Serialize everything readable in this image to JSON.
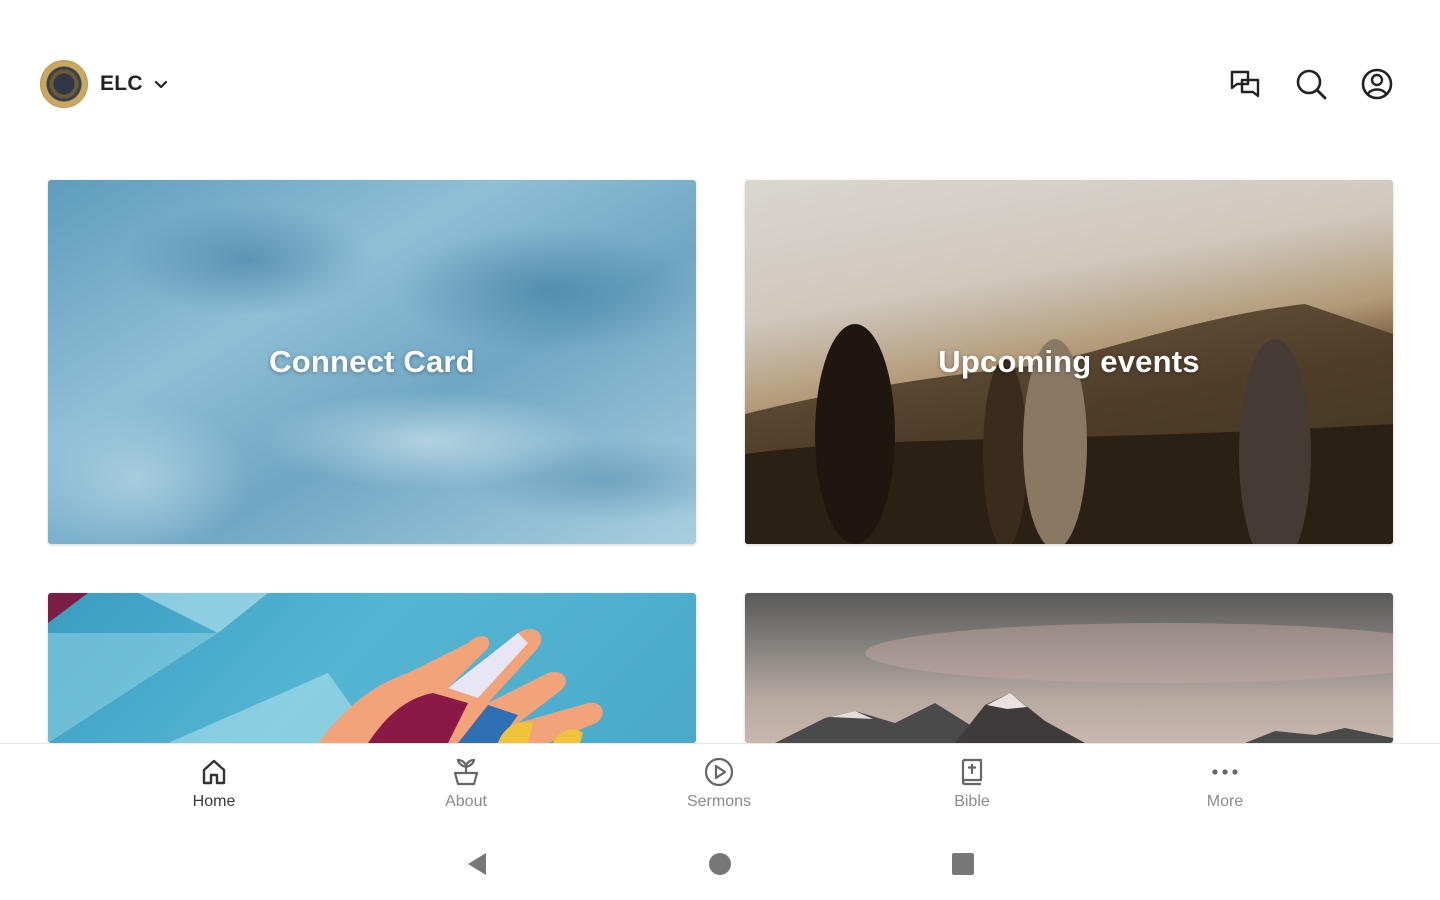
{
  "header": {
    "org_name": "ELC",
    "icons": [
      "chat-icon",
      "search-icon",
      "profile-icon"
    ]
  },
  "cards": [
    {
      "title": "Connect Card"
    },
    {
      "title": "Upcoming events"
    },
    {
      "title": ""
    },
    {
      "title": ""
    }
  ],
  "bottom_nav": {
    "items": [
      {
        "label": "Home",
        "icon": "home-icon",
        "active": true
      },
      {
        "label": "About",
        "icon": "plant-icon",
        "active": false
      },
      {
        "label": "Sermons",
        "icon": "play-circle-icon",
        "active": false
      },
      {
        "label": "Bible",
        "icon": "bible-icon",
        "active": false
      },
      {
        "label": "More",
        "icon": "more-dots-icon",
        "active": false
      }
    ]
  },
  "system_nav": [
    "back-icon",
    "home-circle-icon",
    "recents-icon"
  ],
  "colors": {
    "active_nav": "#3a3a3a",
    "inactive_nav": "#8a8a8a",
    "logo_gold": "#c9a75e"
  }
}
